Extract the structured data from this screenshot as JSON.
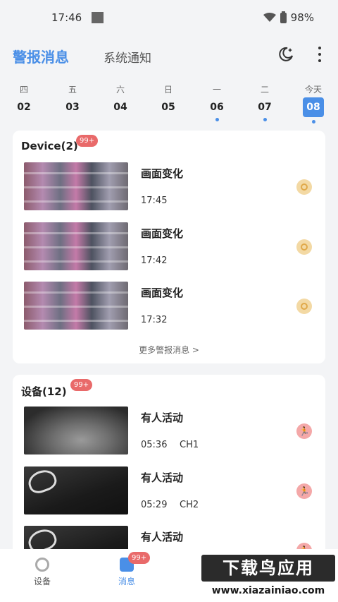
{
  "status_bar": {
    "time": "17:46",
    "battery": "98%"
  },
  "header": {
    "tabs": [
      {
        "label": "警报消息",
        "active": true
      },
      {
        "label": "系统通知",
        "active": false
      }
    ],
    "icons": [
      "night-mode-icon",
      "more-vertical-icon"
    ]
  },
  "date_strip": [
    {
      "weekday": "四",
      "day": "02",
      "dot": false,
      "today": false
    },
    {
      "weekday": "五",
      "day": "03",
      "dot": false,
      "today": false
    },
    {
      "weekday": "六",
      "day": "04",
      "dot": false,
      "today": false
    },
    {
      "weekday": "日",
      "day": "05",
      "dot": false,
      "today": false
    },
    {
      "weekday": "一",
      "day": "06",
      "dot": true,
      "today": false
    },
    {
      "weekday": "二",
      "day": "07",
      "dot": true,
      "today": false
    },
    {
      "weekday": "今天",
      "day": "08",
      "dot": true,
      "today": true
    }
  ],
  "cards": [
    {
      "title": "Device(2)",
      "badge": "99+",
      "events": [
        {
          "title": "画面变化",
          "time": "17:45",
          "channel": "",
          "icon": "eye-icon"
        },
        {
          "title": "画面变化",
          "time": "17:42",
          "channel": "",
          "icon": "eye-icon"
        },
        {
          "title": "画面变化",
          "time": "17:32",
          "channel": "",
          "icon": "eye-icon"
        }
      ],
      "more": "更多警报消息 >"
    },
    {
      "title": "设备(12)",
      "badge": "99+",
      "events": [
        {
          "title": "有人活动",
          "time": "05:36",
          "channel": "CH1",
          "icon": "running-person-icon"
        },
        {
          "title": "有人活动",
          "time": "05:29",
          "channel": "CH2",
          "icon": "running-person-icon"
        },
        {
          "title": "有人活动",
          "time": "",
          "channel": "",
          "icon": "running-person-icon"
        }
      ]
    }
  ],
  "bottom_nav": [
    {
      "label": "设备",
      "icon": "camera-icon",
      "active": false
    },
    {
      "label": "消息",
      "icon": "message-icon",
      "active": true,
      "badge": "99+"
    }
  ],
  "watermark": {
    "top": "下载鸟应用",
    "bottom": "www.xiazainiao.com"
  },
  "colors": {
    "accent": "#4a8fe7",
    "badge": "#e96a6a",
    "background": "#f3f4f6"
  }
}
